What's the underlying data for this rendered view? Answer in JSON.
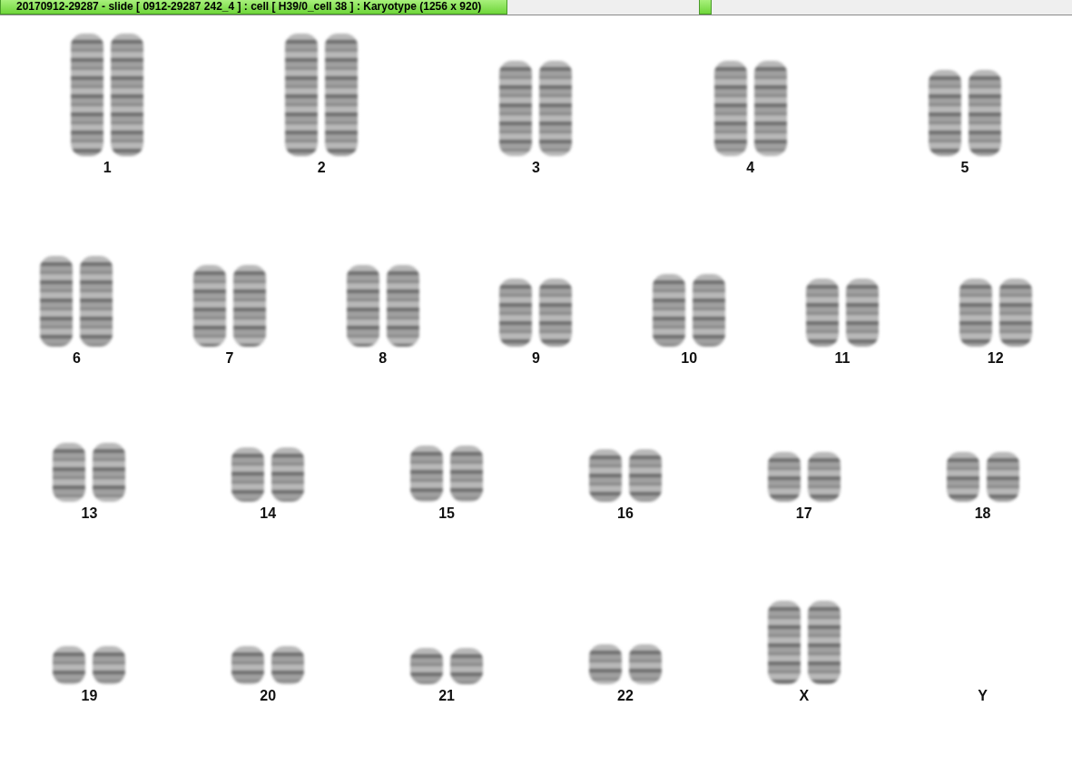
{
  "window": {
    "title": "20170912-29287 - slide [ 0912-29287 242_4 ] : cell [ H39/0_cell 38 ] : Karyotype  (1256 x 920)"
  },
  "karyotype": {
    "rows": [
      {
        "pairs": [
          {
            "label": "1",
            "shown": true
          },
          {
            "label": "2",
            "shown": true
          },
          {
            "label": "3",
            "shown": true
          },
          {
            "label": "4",
            "shown": true
          },
          {
            "label": "5",
            "shown": true
          }
        ]
      },
      {
        "pairs": [
          {
            "label": "6",
            "shown": true
          },
          {
            "label": "7",
            "shown": true
          },
          {
            "label": "8",
            "shown": true
          },
          {
            "label": "9",
            "shown": true
          },
          {
            "label": "10",
            "shown": true
          },
          {
            "label": "11",
            "shown": true
          },
          {
            "label": "12",
            "shown": true
          }
        ]
      },
      {
        "pairs": [
          {
            "label": "13",
            "shown": true
          },
          {
            "label": "14",
            "shown": true
          },
          {
            "label": "15",
            "shown": true
          },
          {
            "label": "16",
            "shown": true
          },
          {
            "label": "17",
            "shown": true
          },
          {
            "label": "18",
            "shown": true
          }
        ]
      },
      {
        "pairs": [
          {
            "label": "19",
            "shown": true
          },
          {
            "label": "20",
            "shown": true
          },
          {
            "label": "21",
            "shown": true
          },
          {
            "label": "22",
            "shown": true
          },
          {
            "label": "X",
            "shown": true
          },
          {
            "label": "Y",
            "shown": false
          }
        ]
      }
    ]
  }
}
